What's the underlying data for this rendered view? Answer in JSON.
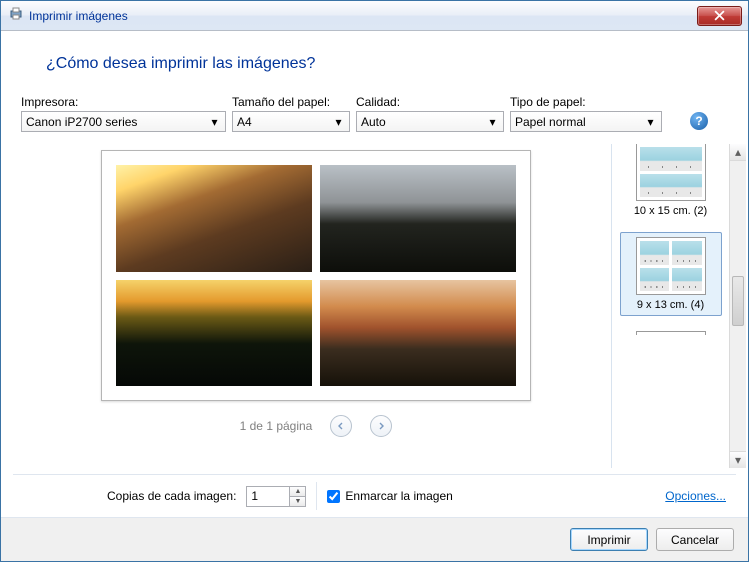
{
  "titlebar": {
    "title": "Imprimir imágenes"
  },
  "question": "¿Cómo desea imprimir las imágenes?",
  "settings": {
    "printer": {
      "label": "Impresora:",
      "value": "Canon iP2700 series"
    },
    "paper_size": {
      "label": "Tamaño del papel:",
      "value": "A4"
    },
    "quality": {
      "label": "Calidad:",
      "value": "Auto"
    },
    "paper_type": {
      "label": "Tipo de papel:",
      "value": "Papel normal"
    }
  },
  "pager": {
    "text": "1 de 1 página"
  },
  "layouts": {
    "item1": {
      "label": "10 x 15 cm. (2)"
    },
    "item2": {
      "label": "9 x 13 cm. (4)"
    }
  },
  "copies": {
    "label": "Copias de cada imagen:",
    "value": "1",
    "frame_label": "Enmarcar la imagen"
  },
  "options_link": "Opciones...",
  "buttons": {
    "print": "Imprimir",
    "cancel": "Cancelar"
  }
}
